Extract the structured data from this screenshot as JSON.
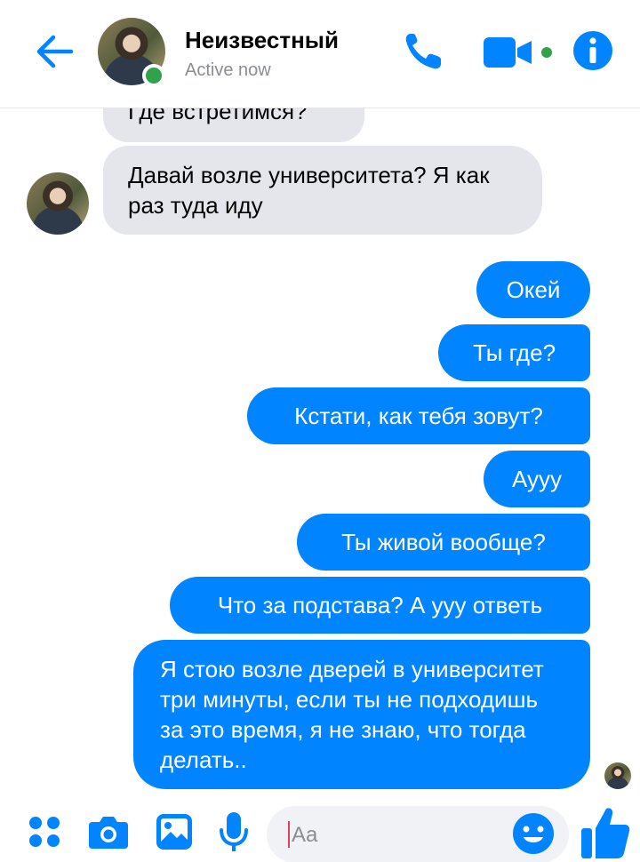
{
  "header": {
    "contact_name": "Неизвестный",
    "status": "Active now",
    "icons": [
      "back-arrow-icon",
      "phone-icon",
      "video-camera-icon",
      "info-icon"
    ]
  },
  "messages": [
    {
      "direction": "incoming",
      "text": "Где встретимся?"
    },
    {
      "direction": "incoming",
      "text": "Давай возле университета? Я как раз туда иду"
    },
    {
      "direction": "outgoing",
      "text": "Окей"
    },
    {
      "direction": "outgoing",
      "text": "Ты где?"
    },
    {
      "direction": "outgoing",
      "text": "Кстати, как тебя зовут?"
    },
    {
      "direction": "outgoing",
      "text": "Аууу"
    },
    {
      "direction": "outgoing",
      "text": "Ты живой вообще?"
    },
    {
      "direction": "outgoing",
      "text": "Что за подстава? А ууу ответь"
    },
    {
      "direction": "outgoing",
      "text": "Я стою возле дверей в университет три минуты, если ты не подходишь за это время, я не знаю, что тогда делать.."
    }
  ],
  "composer": {
    "placeholder": "Aa",
    "icons": [
      "menu-dots-icon",
      "camera-icon",
      "gallery-icon",
      "microphone-icon",
      "emoji-icon",
      "like-icon"
    ]
  },
  "colors": {
    "accent": "#0084ff",
    "incoming_bubble": "#e4e6eb",
    "online": "#31a24c"
  }
}
